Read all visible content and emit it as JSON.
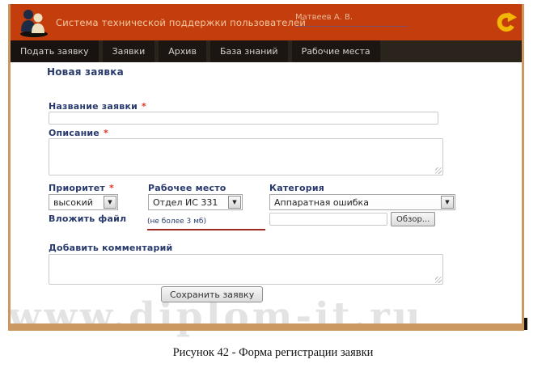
{
  "header": {
    "title": "Система технической поддержки пользователей",
    "user_link": "Матвеев А. В.",
    "logo_icon": "two-users-icon",
    "exit_icon": "logout-arrow-icon"
  },
  "nav": {
    "tabs": [
      {
        "label": "Подать заявку",
        "active": true
      },
      {
        "label": "Заявки",
        "active": false
      },
      {
        "label": "Архив",
        "active": false
      },
      {
        "label": "База знаний",
        "active": false
      },
      {
        "label": "Рабочие места",
        "active": false
      }
    ]
  },
  "form": {
    "heading": "Новая заявка",
    "required_marker": "*",
    "title_field": {
      "label": "Название заявки",
      "value": ""
    },
    "description_field": {
      "label": "Описание",
      "value": ""
    },
    "priority_field": {
      "label": "Приоритет",
      "value": "высокий"
    },
    "workplace_field": {
      "label": "Рабочее место",
      "value": "Отдел ИС 331"
    },
    "category_field": {
      "label": "Категория",
      "value": "Аппаратная ошибка"
    },
    "attach_field": {
      "label": "Вложить файл",
      "hint": "(не более 3 мб)",
      "value": "",
      "browse_label": "Обзор..."
    },
    "comment_field": {
      "label": "Добавить комментарий",
      "value": ""
    },
    "submit_label": "Сохранить заявку"
  },
  "icons": {
    "dropdown_arrow": "▼"
  },
  "watermark": "www.diplom-it.ru",
  "caption": "Рисунок 42 - Форма регистрации заявки",
  "colors": {
    "header_bg": "#c33d0d",
    "header_text": "#f2c9a2",
    "nav_bg": "#2a241d",
    "tab_bg": "#1b1611",
    "frame_border": "#cb9861",
    "label_text": "#293a6d",
    "required_red": "#e03322",
    "hint_underline": "#9e2a22",
    "exit_icon_gold": "#f2b705"
  }
}
